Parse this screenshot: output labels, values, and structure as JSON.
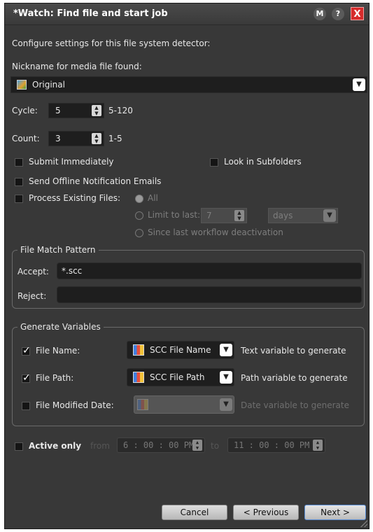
{
  "window": {
    "title": "*Watch: Find file and start job",
    "btn_m": "M",
    "btn_help": "?",
    "btn_close": "X"
  },
  "intro": "Configure settings for this file system detector:",
  "nickname": {
    "label": "Nickname for media file found:",
    "value": "Original"
  },
  "cycle": {
    "label": "Cycle:",
    "value": "5",
    "range": "5-120"
  },
  "count": {
    "label": "Count:",
    "value": "3",
    "range": "1-5"
  },
  "options": {
    "submit_immediately": {
      "label": "Submit Immediately",
      "checked": false
    },
    "look_in_subfolders": {
      "label": "Look in Subfolders",
      "checked": false
    },
    "send_offline": {
      "label": "Send Offline Notification Emails",
      "checked": false
    },
    "process_existing": {
      "label": "Process Existing Files:",
      "checked": false
    }
  },
  "process_existing": {
    "all": "All",
    "limit": "Limit to last:",
    "limit_value": "7",
    "limit_unit": "days",
    "since": "Since last workflow deactivation"
  },
  "file_match": {
    "legend": "File Match Pattern",
    "accept_label": "Accept:",
    "accept_value": "*.scc",
    "reject_label": "Reject:",
    "reject_value": ""
  },
  "generate_vars": {
    "legend": "Generate Variables",
    "rows": [
      {
        "label": "File Name:",
        "checked": true,
        "value": "SCC File Name",
        "desc": "Text variable to generate"
      },
      {
        "label": "File Path:",
        "checked": true,
        "value": "SCC File Path",
        "desc": "Path variable to generate"
      },
      {
        "label": "File Modified Date:",
        "checked": false,
        "value": "",
        "desc": "Date variable to generate"
      }
    ]
  },
  "active_only": {
    "label": "Active only",
    "from": "from",
    "from_time": "6 : 00 : 00  PM",
    "to": "to",
    "to_time": "11 : 00 : 00  PM"
  },
  "buttons": {
    "cancel": "Cancel",
    "previous": "< Previous",
    "next": "Next >"
  },
  "icons": {
    "media": "media-file-icon",
    "variable": "variable-icon",
    "dropdown": "chevron-down-icon",
    "spin": "spin-updown-icon"
  }
}
